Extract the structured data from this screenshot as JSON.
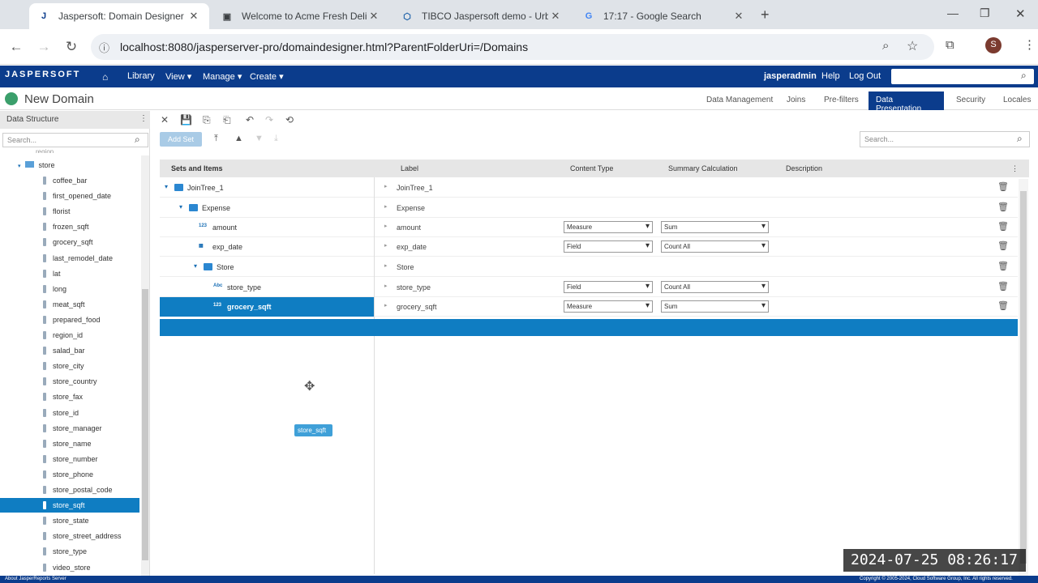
{
  "browser": {
    "tabs": [
      {
        "title": "Jaspersoft: Domain Designer",
        "icon": "J"
      },
      {
        "title": "Welcome to Acme Fresh Delive",
        "icon": "▣"
      },
      {
        "title": "TIBCO Jaspersoft demo - Urba",
        "icon": "⬡"
      },
      {
        "title": "17:17 - Google Search",
        "icon": "G"
      }
    ],
    "url": "localhost:8080/jasperserver-pro/domaindesigner.html?ParentFolderUri=/Domains",
    "profile_initial": "S"
  },
  "app": {
    "logo": "JASPERSOFT",
    "menu": [
      "Library",
      "View",
      "Manage",
      "Create"
    ],
    "user": "jasperadmin",
    "help": "Help",
    "logout": "Log Out",
    "page_title": "New Domain",
    "designer_tabs": [
      "Data Management",
      "Joins",
      "Pre-filters",
      "Data Presentation",
      "Security",
      "Locales"
    ]
  },
  "left_panel": {
    "title": "Data Structure",
    "search_placeholder": "Search...",
    "partial_item": "region",
    "table": "store",
    "items": [
      "coffee_bar",
      "first_opened_date",
      "florist",
      "frozen_sqft",
      "grocery_sqft",
      "last_remodel_date",
      "lat",
      "long",
      "meat_sqft",
      "prepared_food",
      "region_id",
      "salad_bar",
      "store_city",
      "store_country",
      "store_fax",
      "store_id",
      "store_manager",
      "store_name",
      "store_number",
      "store_phone",
      "store_postal_code",
      "store_sqft",
      "store_state",
      "store_street_address",
      "store_type",
      "video_store"
    ],
    "selected": "store_sqft"
  },
  "toolbar": {
    "add_set": "Add Set",
    "search_placeholder": "Search..."
  },
  "grid": {
    "headers": {
      "sets": "Sets and Items",
      "label": "Label",
      "content_type": "Content Type",
      "summary": "Summary Calculation",
      "description": "Description"
    },
    "rows": [
      {
        "name": "JoinTree_1",
        "label": "JoinTree_1",
        "type": "",
        "summary": ""
      },
      {
        "name": "Expense",
        "label": "Expense",
        "type": "",
        "summary": ""
      },
      {
        "name": "amount",
        "label": "amount",
        "type": "Measure",
        "summary": "Sum",
        "icon": "123"
      },
      {
        "name": "exp_date",
        "label": "exp_date",
        "type": "Field",
        "summary": "Count All",
        "icon": "cal"
      },
      {
        "name": "Store",
        "label": "Store",
        "type": "",
        "summary": ""
      },
      {
        "name": "store_type",
        "label": "store_type",
        "type": "Field",
        "summary": "Count All",
        "icon": "Abc"
      },
      {
        "name": "grocery_sqft",
        "label": "grocery_sqft",
        "type": "Measure",
        "summary": "Sum",
        "icon": "123"
      }
    ]
  },
  "drag_label": "store_sqft",
  "footer": {
    "left": "About JasperReports Server",
    "right": "Copyright © 2005-2024, Cloud Software Group, Inc. All rights reserved."
  },
  "timestamp": "2024-07-25  08:26:17"
}
